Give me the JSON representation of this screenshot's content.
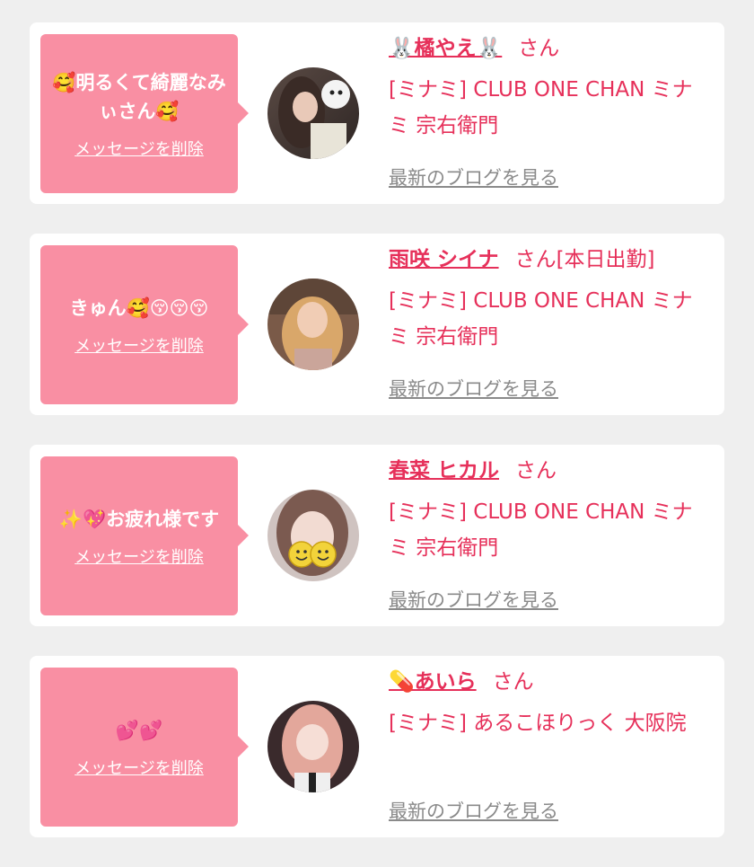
{
  "messages": [
    {
      "message": "🥰明るくて綺麗なみぃさん🥰",
      "delete_label": "メッセージを削除",
      "name": "🐰橘やえ🐰",
      "honorific": "さん",
      "status": "",
      "shop": "[ミナミ] CLUB ONE CHAN ミナミ 宗右衛門",
      "blog_label": "最新のブログを見る",
      "avatar_icon": "woman-photo-avatar-icon"
    },
    {
      "message": "きゅん🥰😚😚😚",
      "delete_label": "メッセージを削除",
      "name": "雨咲 シイナ",
      "honorific": "さん",
      "status": "[本日出勤]",
      "shop": "[ミナミ] CLUB ONE CHAN ミナミ 宗右衛門",
      "blog_label": "最新のブログを見る",
      "avatar_icon": "woman-photo-avatar-icon"
    },
    {
      "message": "✨💖お疲れ様です",
      "delete_label": "メッセージを削除",
      "name": "春菜 ヒカル",
      "honorific": "さん",
      "status": "",
      "shop": "[ミナミ] CLUB ONE CHAN ミナミ 宗右衛門",
      "blog_label": "最新のブログを見る",
      "avatar_icon": "smiley-face-avatar-icon"
    },
    {
      "message": "💕💕",
      "delete_label": "メッセージを削除",
      "name": "💊あいら",
      "honorific": "さん",
      "status": "",
      "shop": "[ミナミ] あるこほりっく 大阪院",
      "blog_label": "最新のブログを見る",
      "avatar_icon": "woman-photo-avatar-icon"
    }
  ],
  "colors": {
    "page_bg": "#efefef",
    "bubble": "#f98fa3",
    "accent": "#e6305a",
    "link_gray": "#8a8a8a"
  }
}
